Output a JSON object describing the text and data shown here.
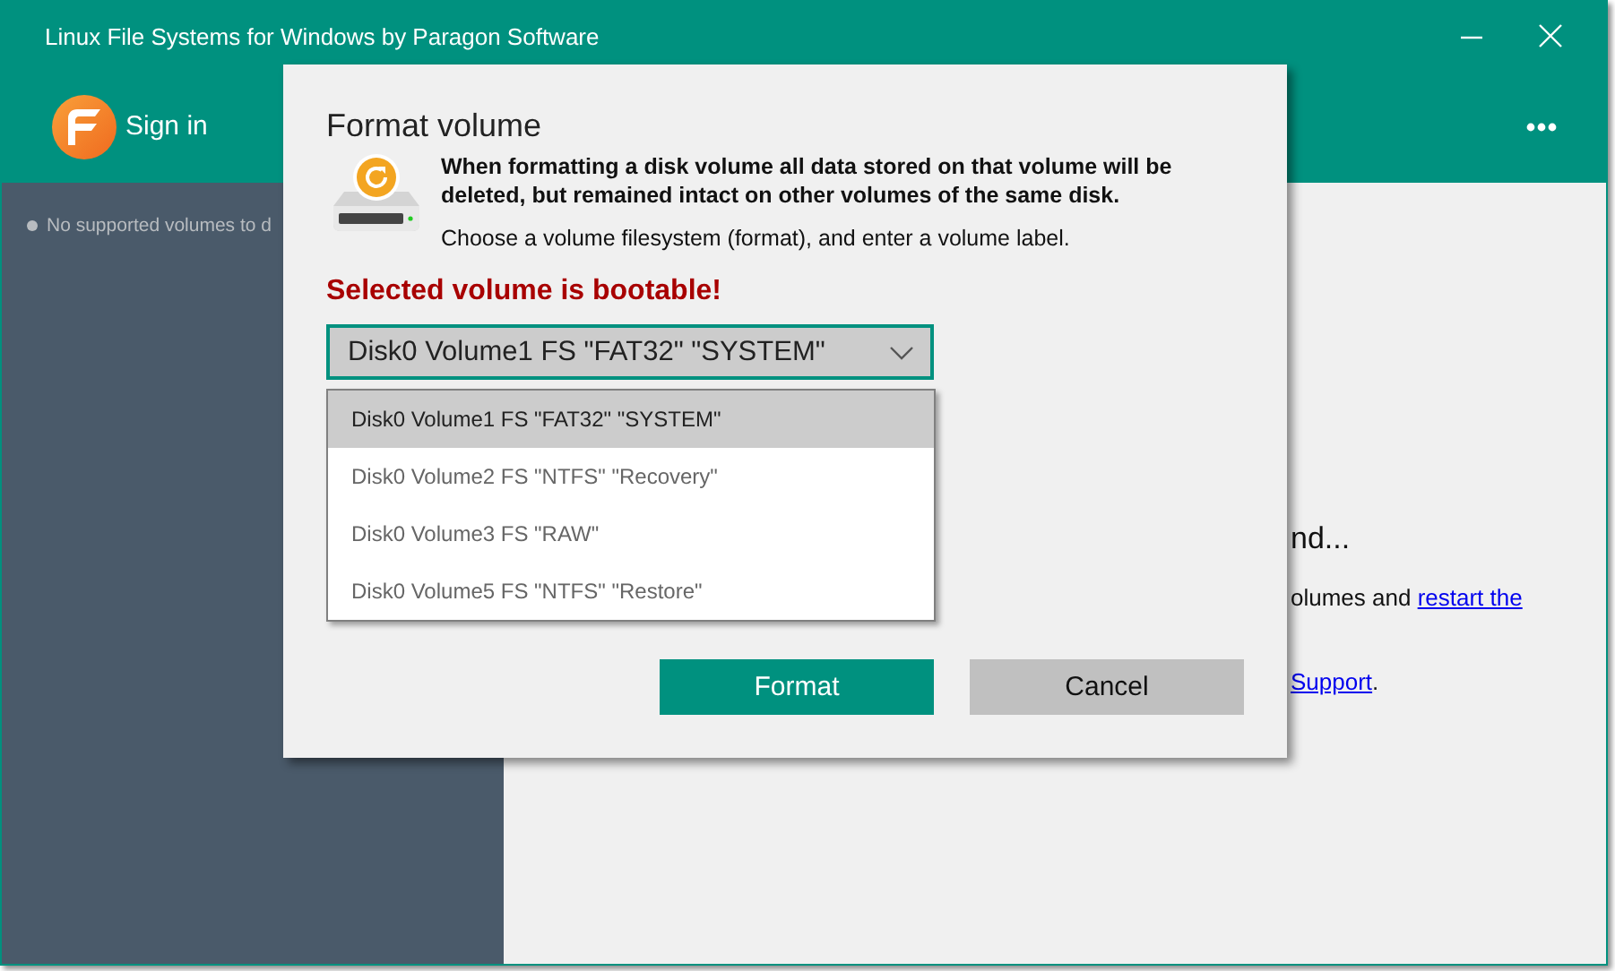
{
  "window": {
    "title": "Linux File Systems for Windows by Paragon Software"
  },
  "header": {
    "sign_in": "Sign in"
  },
  "sidebar": {
    "items": [
      {
        "label": "No supported volumes to d"
      }
    ]
  },
  "main": {
    "heading": "nd...",
    "line_1": {
      "text": "olumes and ",
      "link": "restart the"
    },
    "line_2": {
      "link": "Support",
      "text": "."
    }
  },
  "dialog": {
    "title": "Format volume",
    "warning": "When formatting a disk volume all data stored on that volume will be deleted, but remained intact on other volumes of the same disk.",
    "instruction": "Choose a volume filesystem (format), and enter a volume label.",
    "alert": "Selected volume is bootable!",
    "volume_select": {
      "value": "Disk0 Volume1 FS \"FAT32\" \"SYSTEM\"",
      "expanded": true
    },
    "options": [
      {
        "label": "Disk0 Volume1 FS \"FAT32\" \"SYSTEM\"",
        "selected": true
      },
      {
        "label": "Disk0 Volume2 FS \"NTFS\" \"Recovery\"",
        "selected": false
      },
      {
        "label": "Disk0 Volume3 FS \"RAW\"",
        "selected": false
      },
      {
        "label": "Disk0 Volume5 FS \"NTFS\" \"Restore\"",
        "selected": false
      }
    ],
    "buttons": [
      {
        "label": "Format",
        "kind": "primary"
      },
      {
        "label": "Cancel",
        "kind": "secondary"
      }
    ]
  }
}
